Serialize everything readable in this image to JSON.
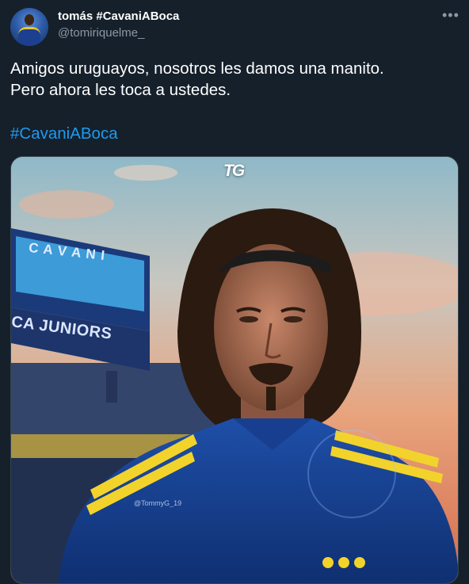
{
  "tweet": {
    "display_name": "tomás #CavaniABoca",
    "handle": "@tomiriquelme_",
    "more_icon": "•••",
    "text": "Amigos uruguayos, nosotros les damos una manito.\nPero ahora les toca a ustedes.",
    "hashtag": "#CavaniABoca"
  },
  "media": {
    "logo": "TG",
    "board_title": "C A V A N I",
    "board_subtitle": "CA JUNIORS",
    "watermark": "@TommyG_19"
  }
}
